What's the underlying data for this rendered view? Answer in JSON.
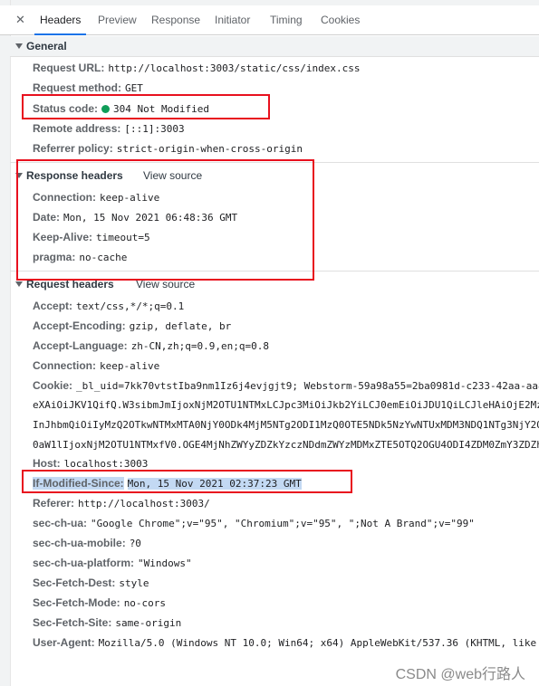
{
  "tabs": [
    {
      "label": "Headers"
    },
    {
      "label": "Preview"
    },
    {
      "label": "Response"
    },
    {
      "label": "Initiator"
    },
    {
      "label": "Timing"
    },
    {
      "label": "Cookies"
    }
  ],
  "close_glyph": "✕",
  "general": {
    "title": "General",
    "request_url": {
      "key": "Request URL:",
      "value": "http://localhost:3003/static/css/index.css"
    },
    "request_method": {
      "key": "Request method:",
      "value": "GET"
    },
    "status_code": {
      "key": "Status code:",
      "value": "304 Not Modified",
      "status_color": "#0f9d58"
    },
    "remote_address": {
      "key": "Remote address:",
      "value": "[::1]:3003"
    },
    "referrer_policy": {
      "key": "Referrer policy:",
      "value": "strict-origin-when-cross-origin"
    }
  },
  "response_headers": {
    "title": "Response headers",
    "view_source": "View source",
    "connection": {
      "key": "Connection:",
      "value": "keep-alive"
    },
    "date": {
      "key": "Date:",
      "value": "Mon, 15 Nov 2021 06:48:36 GMT"
    },
    "keep_alive": {
      "key": "Keep-Alive:",
      "value": "timeout=5"
    },
    "pragma": {
      "key": "pragma:",
      "value": "no-cache"
    }
  },
  "request_headers": {
    "title": "Request headers",
    "view_source": "View source",
    "accept": {
      "key": "Accept:",
      "value": "text/css,*/*;q=0.1"
    },
    "accept_encoding": {
      "key": "Accept-Encoding:",
      "value": "gzip, deflate, br"
    },
    "accept_language": {
      "key": "Accept-Language:",
      "value": "zh-CN,zh;q=0.9,en;q=0.8"
    },
    "connection": {
      "key": "Connection:",
      "value": "keep-alive"
    },
    "cookie": {
      "key": "Cookie:",
      "value": "_bl_uid=7kk70vtstIba9nm1Iz6j4evjgjt9; Webstorm-59a98a55=2ba0981d-c233-42aa-aa8",
      "lines": [
        "eXAiOiJKV1QifQ.W3sibmJmIjoxNjM2OTU1NTMxLCJpc3MiOiJkb2YiLCJ0emEiOiJDU1QiLCJleHAiOjE2Mz",
        "InJhbmQiOiIyMzQ2OTkwNTMxMTA0NjY0ODk4MjM5NTg2ODI1MzQ0OTE5NDk5NzYwNTUxMDM3NDQ1NTg3NjY2O",
        "0aW1lIjoxNjM2OTU1NTMxfV0.OGE4MjNhZWYyZDZkYzczNDdmZWYzMDMxZTE5OTQ2OGU4ODI4ZDM0ZmY3ZDZh"
      ]
    },
    "host": {
      "key": "Host:",
      "value": "localhost:3003"
    },
    "if_modified_since": {
      "key": "If-Modified-Since:",
      "value": "Mon, 15 Nov 2021 02:37:23 GMT"
    },
    "referer": {
      "key": "Referer:",
      "value": "http://localhost:3003/"
    },
    "sec_ch_ua": {
      "key": "sec-ch-ua:",
      "value": "\"Google Chrome\";v=\"95\", \"Chromium\";v=\"95\", \";Not A Brand\";v=\"99\""
    },
    "sec_ch_ua_mobile": {
      "key": "sec-ch-ua-mobile:",
      "value": "?0"
    },
    "sec_ch_ua_platform": {
      "key": "sec-ch-ua-platform:",
      "value": "\"Windows\""
    },
    "sec_fetch_dest": {
      "key": "Sec-Fetch-Dest:",
      "value": "style"
    },
    "sec_fetch_mode": {
      "key": "Sec-Fetch-Mode:",
      "value": "no-cors"
    },
    "sec_fetch_site": {
      "key": "Sec-Fetch-Site:",
      "value": "same-origin"
    },
    "user_agent": {
      "key": "User-Agent:",
      "value": "Mozilla/5.0 (Windows NT 10.0; Win64; x64) AppleWebKit/537.36 (KHTML, like"
    }
  },
  "watermark": "CSDN @web行路人",
  "colors": {
    "accent": "#1a73e8",
    "highlight_box": "#e8101e",
    "selection": "#c3d9f3"
  }
}
